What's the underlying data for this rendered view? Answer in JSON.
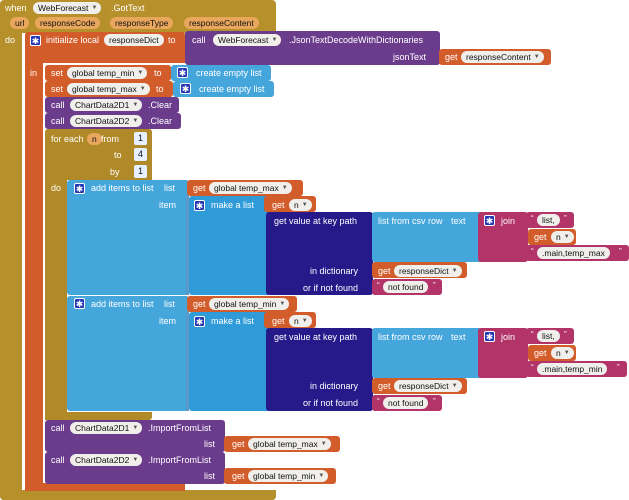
{
  "event": {
    "when": "when",
    "component": "WebForecast",
    "event_name": ".GotText",
    "params": [
      "url",
      "responseCode",
      "responseType",
      "responseContent"
    ],
    "do": "do"
  },
  "init_local": {
    "label": "initialize local",
    "var": "responseDict",
    "to": "to",
    "call": "call",
    "component": "WebForecast",
    "method": ".JsonTextDecodeWithDictionaries",
    "arg_label": "jsonText",
    "get": "get",
    "arg_var": "responseContent",
    "in": "in"
  },
  "set1": {
    "set": "set",
    "var": "global temp_min",
    "to": "to",
    "value": "create empty list"
  },
  "set2": {
    "set": "set",
    "var": "global temp_max",
    "to": "to",
    "value": "create empty list"
  },
  "clear1": {
    "call": "call",
    "component": "ChartData2D1",
    "method": ".Clear"
  },
  "clear2": {
    "call": "call",
    "component": "ChartData2D2",
    "method": ".Clear"
  },
  "loop": {
    "for_each": "for each",
    "var": "n",
    "from": "from",
    "from_val": "1",
    "to": "to",
    "to_val": "4",
    "by": "by",
    "by_val": "1",
    "do": "do"
  },
  "add1": {
    "label": "add items to list",
    "list_label": "list",
    "get": "get",
    "list_var": "global temp_max",
    "item_label": "item",
    "make_list": "make a list",
    "get_n": "n",
    "kv": "get value at key path",
    "csv": "list from csv row",
    "text": "text",
    "join": "join",
    "s1": "list,",
    "s2": ".main,temp_max",
    "in_dict": "in dictionary",
    "dict_var": "responseDict",
    "not_found_label": "or if not found",
    "not_found": "not found"
  },
  "add2": {
    "label": "add items to list",
    "list_label": "list",
    "get": "get",
    "list_var": "global temp_min",
    "item_label": "item",
    "make_list": "make a list",
    "get_n": "n",
    "kv": "get value at key path",
    "csv": "list from csv row",
    "text": "text",
    "join": "join",
    "s1": "list,",
    "s2": ".main,temp_min",
    "in_dict": "in dictionary",
    "dict_var": "responseDict",
    "not_found_label": "or if not found",
    "not_found": "not found"
  },
  "import1": {
    "call": "call",
    "component": "ChartData2D1",
    "method": ".ImportFromList",
    "list_label": "list",
    "get": "get",
    "var": "global temp_max"
  },
  "import2": {
    "call": "call",
    "component": "ChartData2D2",
    "method": ".ImportFromList",
    "list_label": "list",
    "get": "get",
    "var": "global temp_min"
  },
  "colors": {
    "event": "#b5902b",
    "local": "#d35d2a",
    "component": "#6b3c8c",
    "list": "#45a6dc",
    "text": "#b33468",
    "dictionary": "#261a8a"
  }
}
